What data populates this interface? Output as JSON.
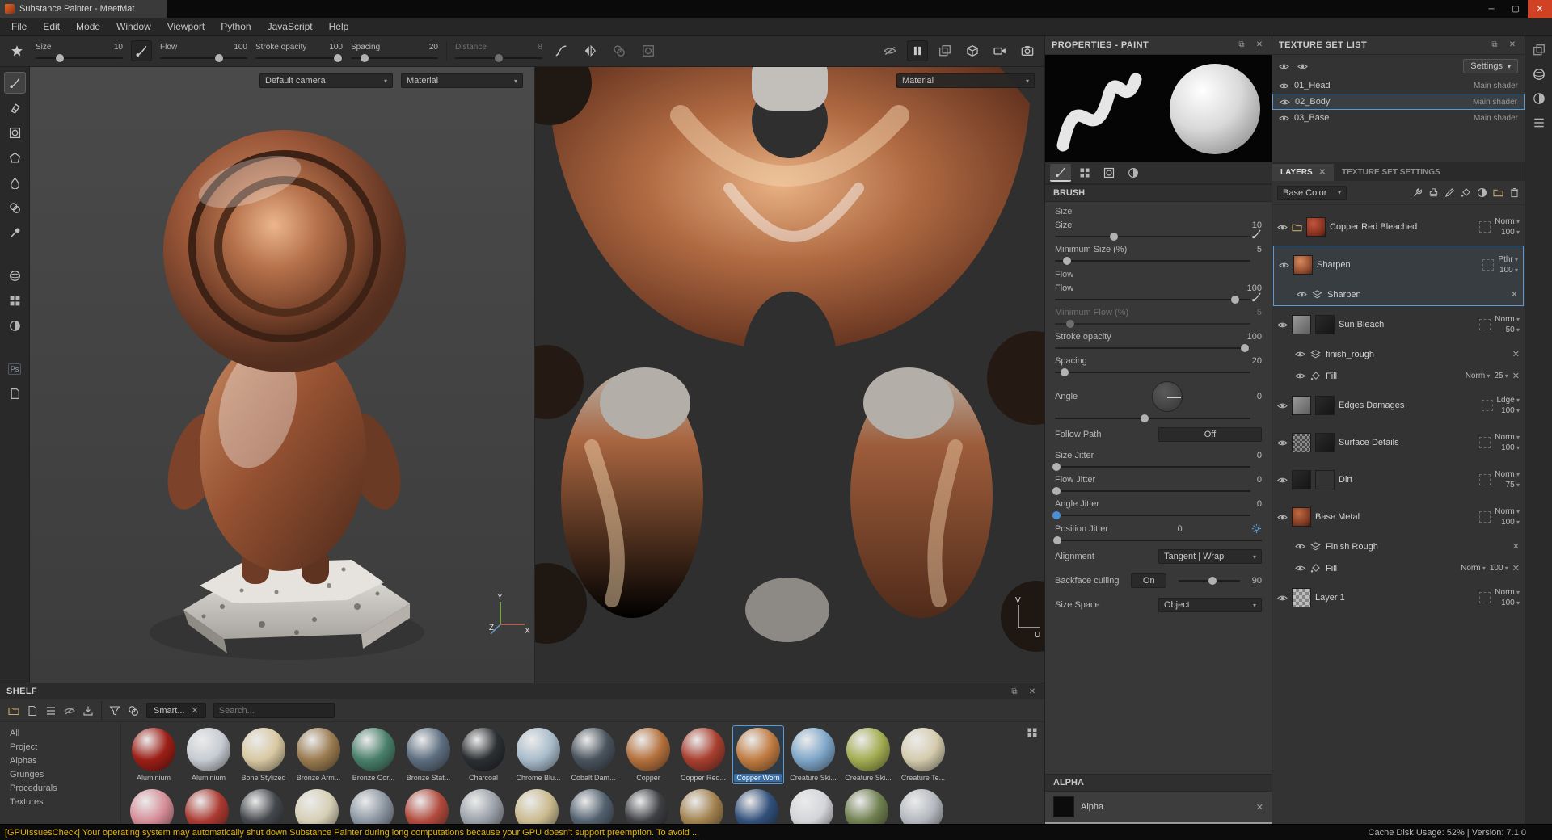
{
  "titlebar": {
    "title": "Substance Painter - MeetMat"
  },
  "menubar": {
    "items": [
      "File",
      "Edit",
      "Mode",
      "Window",
      "Viewport",
      "Python",
      "JavaScript",
      "Help"
    ]
  },
  "toolbar": {
    "size_label": "Size",
    "size_value": "10",
    "flow_label": "Flow",
    "flow_value": "100",
    "opacity_label": "Stroke opacity",
    "opacity_value": "100",
    "spacing_label": "Spacing",
    "spacing_value": "20",
    "distance_label": "Distance",
    "distance_value": "8"
  },
  "viewport3d": {
    "camera": "Default camera",
    "shading": "Material",
    "axis_x": "X",
    "axis_y": "Y",
    "axis_z": "Z"
  },
  "viewport2d": {
    "shading": "Material",
    "axis_u": "U",
    "axis_v": "V"
  },
  "properties": {
    "title": "PROPERTIES - PAINT",
    "brush_section": "BRUSH",
    "size_group": "Size",
    "size_label": "Size",
    "size_value": "10",
    "min_size_label": "Minimum Size (%)",
    "min_size_value": "5",
    "flow_group": "Flow",
    "flow_label": "Flow",
    "flow_value": "100",
    "min_flow_label": "Minimum Flow (%)",
    "min_flow_value": "5",
    "opacity_label": "Stroke opacity",
    "opacity_value": "100",
    "spacing_label": "Spacing",
    "spacing_value": "20",
    "angle_label": "Angle",
    "angle_value": "0",
    "follow_path_label": "Follow Path",
    "follow_path_value": "Off",
    "size_jitter_label": "Size Jitter",
    "size_jitter_value": "0",
    "flow_jitter_label": "Flow Jitter",
    "flow_jitter_value": "0",
    "angle_jitter_label": "Angle Jitter",
    "angle_jitter_value": "0",
    "position_jitter_label": "Position Jitter",
    "position_jitter_value": "0",
    "alignment_label": "Alignment",
    "alignment_value": "Tangent | Wrap",
    "backface_label": "Backface culling",
    "backface_value": "On",
    "backface_angle": "90",
    "size_space_label": "Size Space",
    "size_space_value": "Object",
    "alpha_section": "ALPHA",
    "alpha_name": "Alpha"
  },
  "texture_sets": {
    "title": "TEXTURE SET LIST",
    "settings_button": "Settings",
    "rows": [
      {
        "name": "01_Head",
        "shader": "Main shader"
      },
      {
        "name": "02_Body",
        "shader": "Main shader"
      },
      {
        "name": "03_Base",
        "shader": "Main shader"
      }
    ]
  },
  "layers": {
    "tab_layers": "LAYERS",
    "tab_settings": "TEXTURE SET SETTINGS",
    "channel": "Base Color",
    "rows": [
      {
        "name": "Copper Red Bleached",
        "blend": "Norm",
        "opacity": "100"
      },
      {
        "name": "Sharpen",
        "blend": "Pthr",
        "opacity": "100"
      },
      {
        "name": "Sharpen"
      },
      {
        "name": "Sun Bleach",
        "blend": "Norm",
        "opacity": "50"
      },
      {
        "name": "finish_rough"
      },
      {
        "name": "Fill",
        "blend": "Norm",
        "opacity": "25"
      },
      {
        "name": "Edges Damages",
        "blend": "Ldge",
        "opacity": "100"
      },
      {
        "name": "Surface Details",
        "blend": "Norm",
        "opacity": "100"
      },
      {
        "name": "Dirt",
        "blend": "Norm",
        "opacity": "75"
      },
      {
        "name": "Base Metal",
        "blend": "Norm",
        "opacity": "100"
      },
      {
        "name": "Finish Rough"
      },
      {
        "name": "Fill",
        "blend": "Norm",
        "opacity": "100"
      },
      {
        "name": "Layer 1",
        "blend": "Norm",
        "opacity": "100"
      }
    ]
  },
  "shelf": {
    "title": "SHELF",
    "filter_tab": "Smart...",
    "search_placeholder": "Search...",
    "categories": [
      "All",
      "Project",
      "Alphas",
      "Grunges",
      "Procedurals",
      "Textures"
    ],
    "materials": [
      {
        "label": "Aluminium",
        "color": "#9c1f17"
      },
      {
        "label": "Aluminium",
        "color": "#c7ccd3"
      },
      {
        "label": "Bone Stylized",
        "color": "#d9c9a3"
      },
      {
        "label": "Bronze Arm...",
        "color": "#9a7b50"
      },
      {
        "label": "Bronze Cor...",
        "color": "#49806b"
      },
      {
        "label": "Bronze Stat...",
        "color": "#5d6e80"
      },
      {
        "label": "Charcoal",
        "color": "#2c2f33"
      },
      {
        "label": "Chrome Blu...",
        "color": "#a9bccb"
      },
      {
        "label": "Cobalt Dam...",
        "color": "#4a545e"
      },
      {
        "label": "Copper",
        "color": "#b5713d"
      },
      {
        "label": "Copper Red...",
        "color": "#a8402f"
      },
      {
        "label": "Copper Worn",
        "color": "#c17c42"
      },
      {
        "label": "Creature Ski...",
        "color": "#7fa7c9"
      },
      {
        "label": "Creature Ski...",
        "color": "#a3ad52"
      },
      {
        "label": "Creature Te...",
        "color": "#d5ccae"
      }
    ],
    "row2_colors": [
      "#d58d97",
      "#ab3a31",
      "#44474c",
      "#d6cfb6",
      "#8b95a1",
      "#b24a3c",
      "#9aa0a8",
      "#caba8e",
      "#52616f",
      "#3d3f43",
      "#a2814f",
      "#31507a",
      "#d3d5d9",
      "#70804f",
      "#b4b8be"
    ]
  },
  "statusbar": {
    "warning": "[GPUIssuesCheck] Your operating system may automatically shut down Substance Painter during long computations because your GPU doesn't support preemption. To avoid ...",
    "info": "Cache Disk Usage:  52% | Version: 7.1.0"
  }
}
